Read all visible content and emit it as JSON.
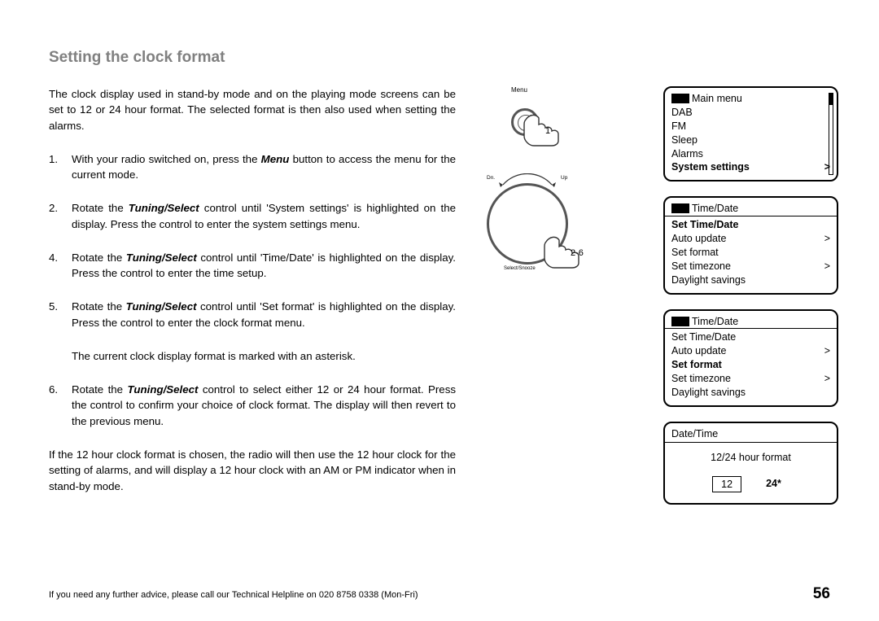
{
  "title": "Setting the clock format",
  "intro": "The clock display used in stand-by mode and on the playing mode screens can be set to 12 or 24 hour format.  The selected format is then also used when setting the alarms.",
  "steps": [
    {
      "n": "1.",
      "pre": "With your radio switched on, press the ",
      "em": "Menu",
      "post": " button to access the menu for the current mode."
    },
    {
      "n": "2.",
      "pre": "Rotate the ",
      "em": "Tuning/Select",
      "post": " control until 'System settings' is highlighted on the display. Press the control to enter the system settings menu."
    },
    {
      "n": "4.",
      "pre": "Rotate the ",
      "em": "Tuning/Select",
      "post": " control until 'Time/Date' is highlighted on the display. Press the control to enter the time setup."
    },
    {
      "n": "5.",
      "pre": "Rotate the ",
      "em": "Tuning/Select",
      "post": " control until 'Set format' is highlighted on the display. Press the control to enter the clock format menu."
    },
    {
      "n": "6.",
      "pre": "Rotate the ",
      "em": "Tuning/Select",
      "post": " control to select either 12 or 24 hour format. Press the control to confirm your choice of clock format. The display will then revert to the previous menu."
    }
  ],
  "note_after_5": "The current clock display format is marked with an asterisk.",
  "trailing": "If the 12 hour clock format is chosen, the radio will then use the 12 hour clock for the setting of alarms, and will display a 12 hour clock with an AM or PM indicator when in stand-by mode.",
  "icons": {
    "menu_label": "Menu",
    "step1": "1",
    "dn": "Dn.",
    "up": "Up",
    "step26": "2-6",
    "select_label": "Select/Snooze"
  },
  "screen1": {
    "title": "Main menu",
    "items": [
      "DAB",
      "FM",
      "Sleep",
      "Alarms"
    ],
    "highlight": "System settings",
    "caret": ">"
  },
  "screen2": {
    "title": "Time/Date",
    "highlight": "Set Time/Date",
    "rows": [
      {
        "label": "Auto update",
        "caret": ">"
      },
      {
        "label": "Set format",
        "caret": ""
      },
      {
        "label": "Set timezone",
        "caret": ">"
      },
      {
        "label": "Daylight savings",
        "caret": ""
      }
    ]
  },
  "screen3": {
    "title": "Time/Date",
    "pre_rows": [
      {
        "label": "Set Time/Date",
        "caret": ""
      },
      {
        "label": "Auto update",
        "caret": ">"
      }
    ],
    "highlight": "Set format",
    "rows": [
      {
        "label": "Set timezone",
        "caret": ">"
      },
      {
        "label": "Daylight savings",
        "caret": ""
      }
    ]
  },
  "screen4": {
    "title": "Date/Time",
    "prompt": "12/24 hour format",
    "opt1": "12",
    "opt2": "24*"
  },
  "footer": "If you need any further advice, please call our Technical Helpline on 020 8758 0338 (Mon-Fri)",
  "page_num": "56"
}
